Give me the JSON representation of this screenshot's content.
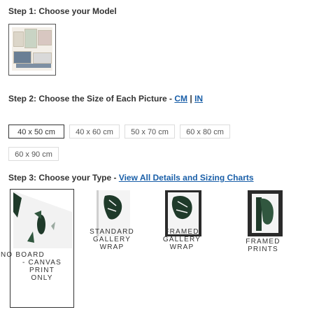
{
  "step1": {
    "title": "Step 1: Choose your Model"
  },
  "step2": {
    "title": "Step 2: Choose the Size of Each Picture - ",
    "unit_cm": "CM",
    "unit_sep": " | ",
    "unit_in": "IN",
    "sizes": [
      {
        "label": "40 x 50 cm",
        "selected": true
      },
      {
        "label": "40 x 60 cm",
        "selected": false
      },
      {
        "label": "50 x 70 cm",
        "selected": false
      },
      {
        "label": "60 x 80 cm",
        "selected": false
      },
      {
        "label": "60 x 90 cm",
        "selected": false
      }
    ]
  },
  "step3": {
    "title": "Step 3: Choose your Type - ",
    "link": "View All Details and Sizing Charts",
    "types": [
      {
        "line1": "NO BOARD",
        "line2": "- CANVAS",
        "line3": "PRINT",
        "line4": "ONLY",
        "selected": true
      },
      {
        "line1": "STANDARD",
        "line2": "GALLERY",
        "line3": "WRAP",
        "selected": false
      },
      {
        "line1": "FRAMED",
        "line2": "GALLERY",
        "line3": "WRAP",
        "selected": false
      },
      {
        "line1": "FRAMED",
        "line2": "PRINTS",
        "selected": false
      }
    ]
  },
  "colors": {
    "link": "#1a5fa8",
    "selected_border": "#333333",
    "plant_dark": "#1f3a2a"
  }
}
